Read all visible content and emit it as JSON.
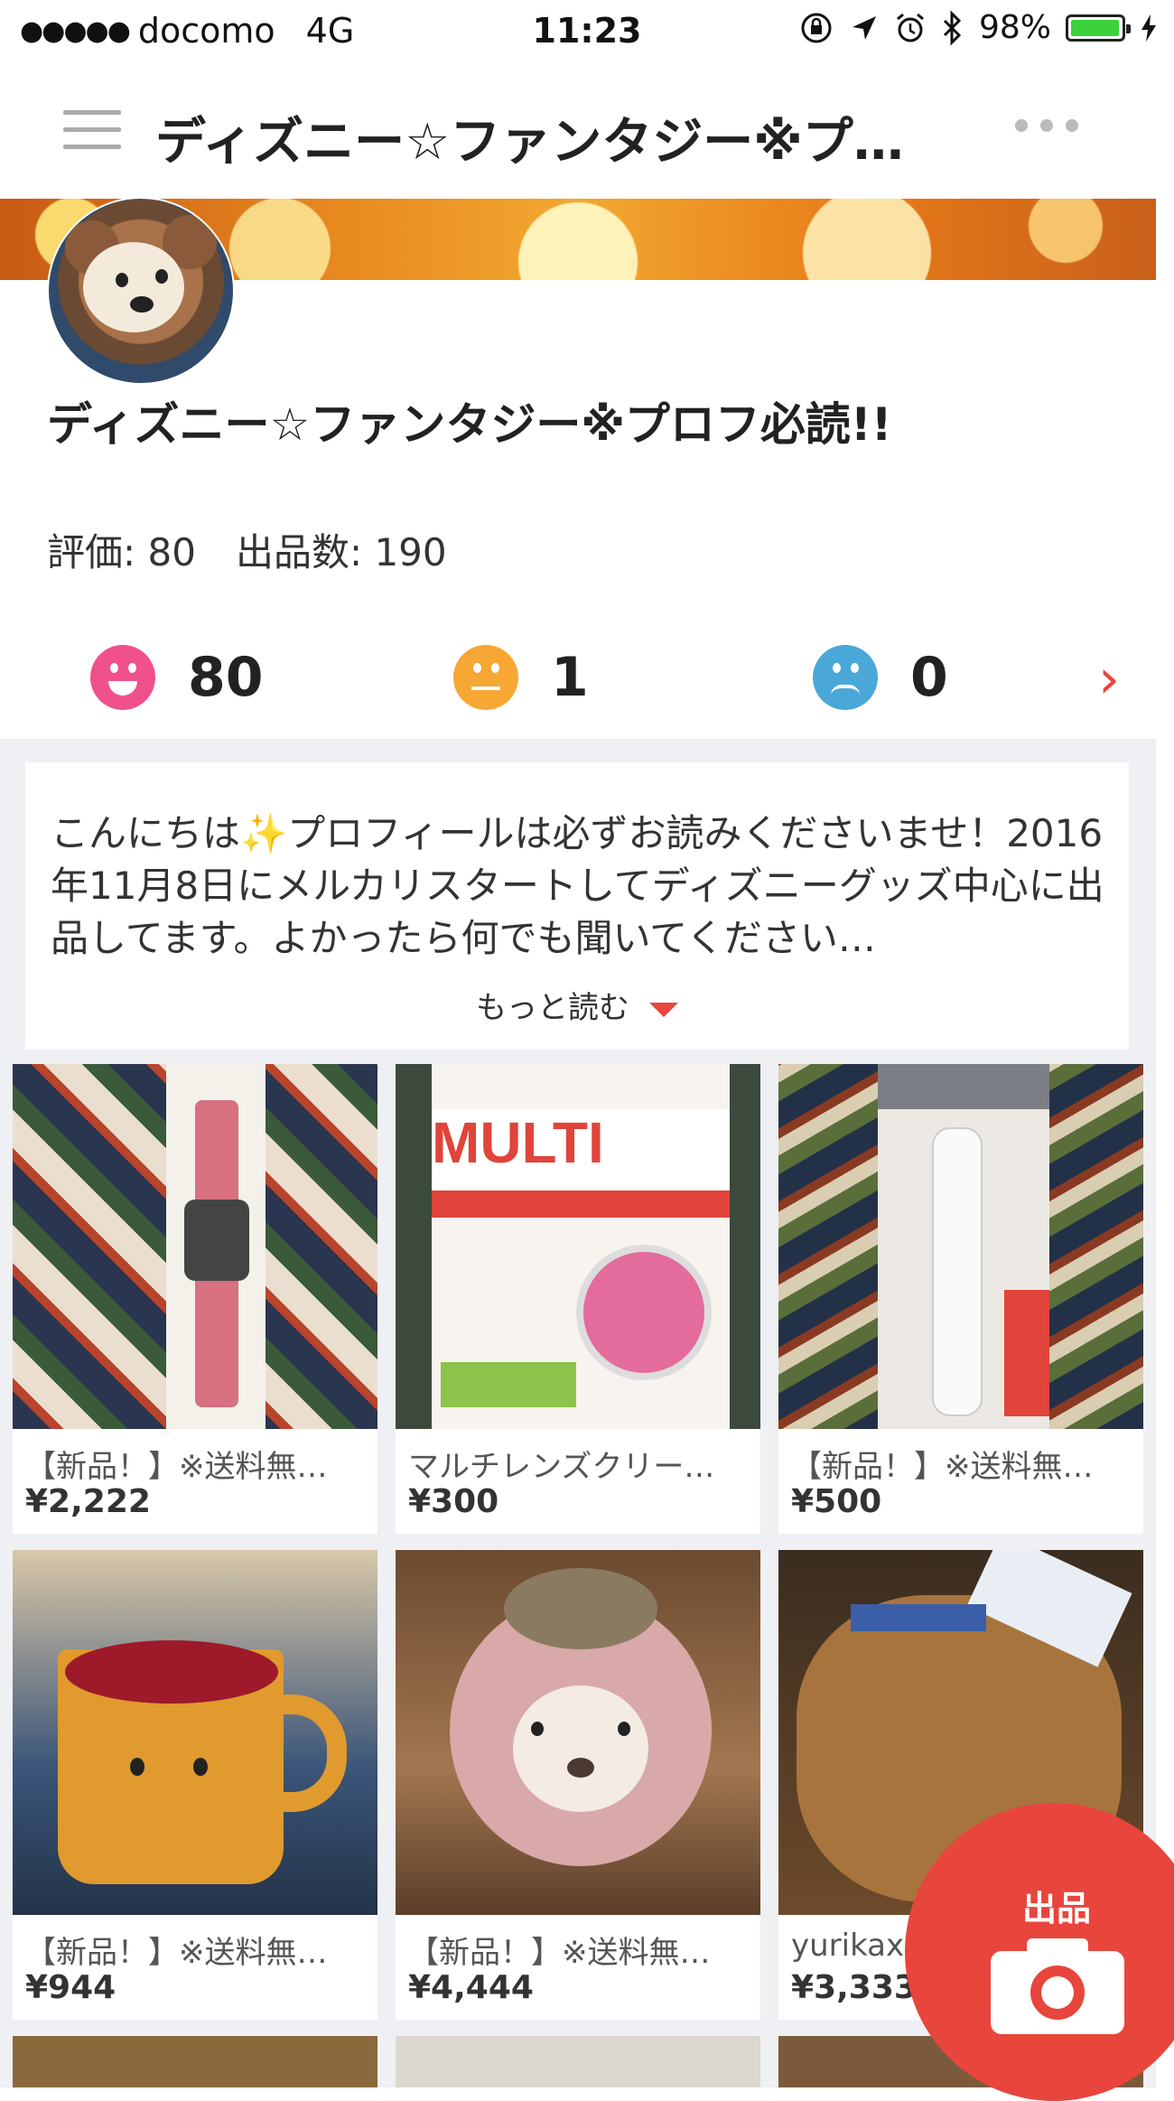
{
  "status_bar": {
    "signal": "●●●●●",
    "carrier": "docomo",
    "network": "4G",
    "time": "11:23",
    "battery": "98%",
    "battery_level": 0.98,
    "battery_color": "#3cd23c"
  },
  "nav": {
    "title": "ディズニー☆ファンタジー※プ…"
  },
  "profile": {
    "name": "ディズニー☆ファンタジー※プロフ必読!!",
    "rating_label": "評価: 80",
    "listings_label": "出品数: 190"
  },
  "ratings": {
    "good": "80",
    "normal": "1",
    "bad": "0",
    "colors": {
      "good": "#f0508c",
      "normal": "#f7a734",
      "bad": "#4aa8d8"
    }
  },
  "intro": {
    "text": "こんにちは✨プロフィールは必ずお読みくださいませ！2016年11月8日にメルカリスタートしてディズニーグッズ中心に出品してます。よかったら何でも聞いてください…",
    "read_more": "もっと読む"
  },
  "products": [
    {
      "name": "【新品！】※送料無…",
      "price": "¥2,222"
    },
    {
      "name": "マルチレンズクリー…",
      "price": "¥300"
    },
    {
      "name": "【新品！】※送料無…",
      "price": "¥500"
    },
    {
      "name": "【新品！】※送料無…",
      "price": "¥944"
    },
    {
      "name": "【新品！】※送料無…",
      "price": "¥4,444"
    },
    {
      "name": "yurikax",
      "price": "¥3,333"
    }
  ],
  "fab": {
    "label": "出品",
    "color": "#e8453c"
  }
}
